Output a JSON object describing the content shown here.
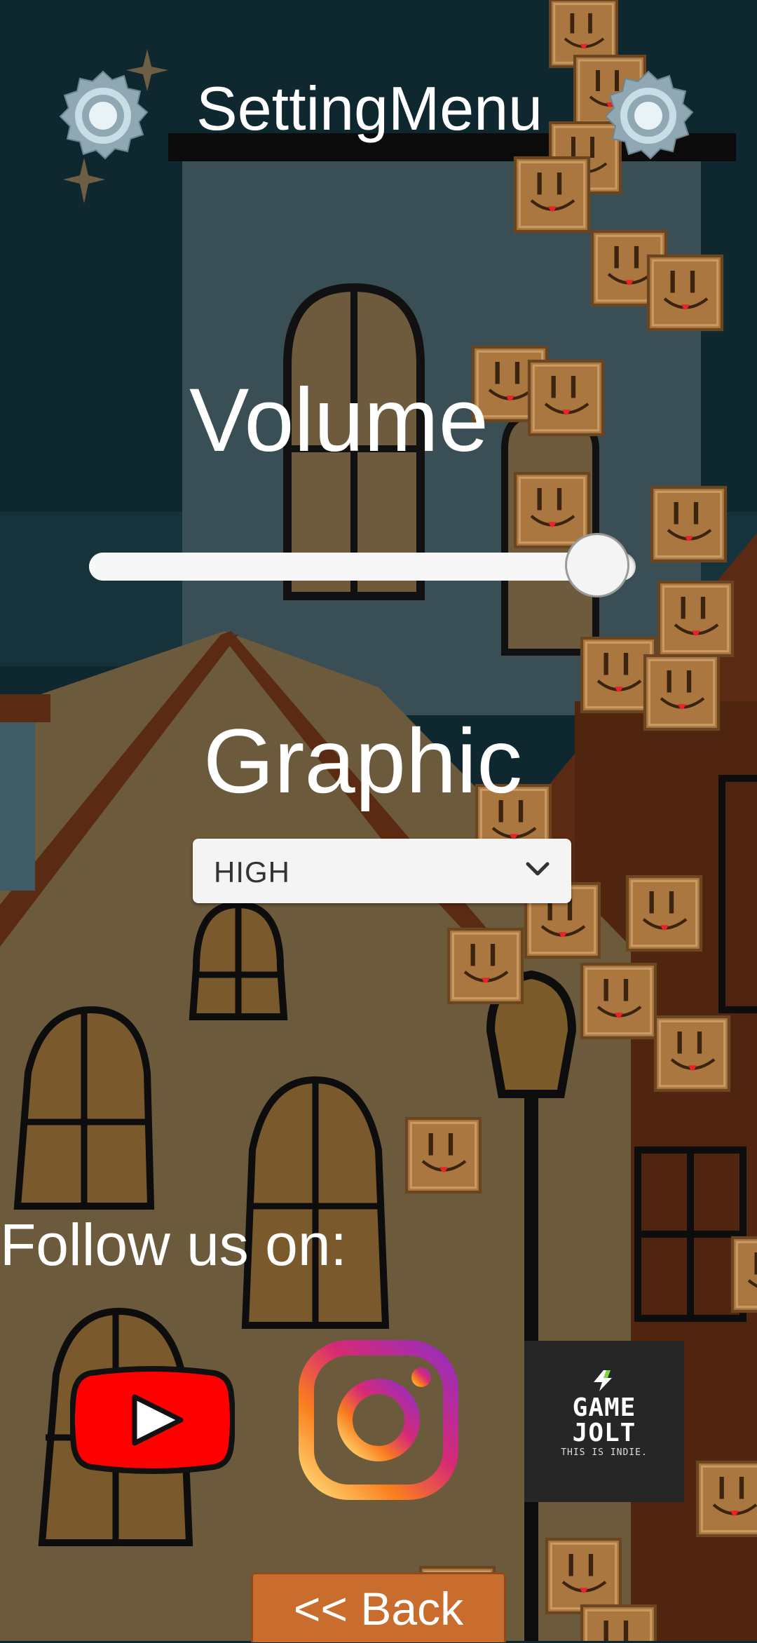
{
  "header": {
    "title": "SettingMenu",
    "left_icon": "gear-icon",
    "right_icon": "gear-icon"
  },
  "volume": {
    "label": "Volume",
    "level": 0.93
  },
  "graphic": {
    "label": "Graphic",
    "selected": "HIGH"
  },
  "social": {
    "label": "Follow us on:",
    "youtube_icon": "youtube-icon",
    "instagram_icon": "instagram-icon",
    "gamejolt": {
      "wordmark": "GAME JOLT",
      "tagline": "THIS IS INDIE."
    }
  },
  "footer": {
    "back_label": "<< Back"
  },
  "colors": {
    "sky": "#0f2830",
    "building_blue": "#3a4e55",
    "roof_brown": "#5a2b12",
    "wall_tan": "#6b5a3c",
    "back_button": "#c86d2e",
    "youtube_red": "#ff0000"
  }
}
